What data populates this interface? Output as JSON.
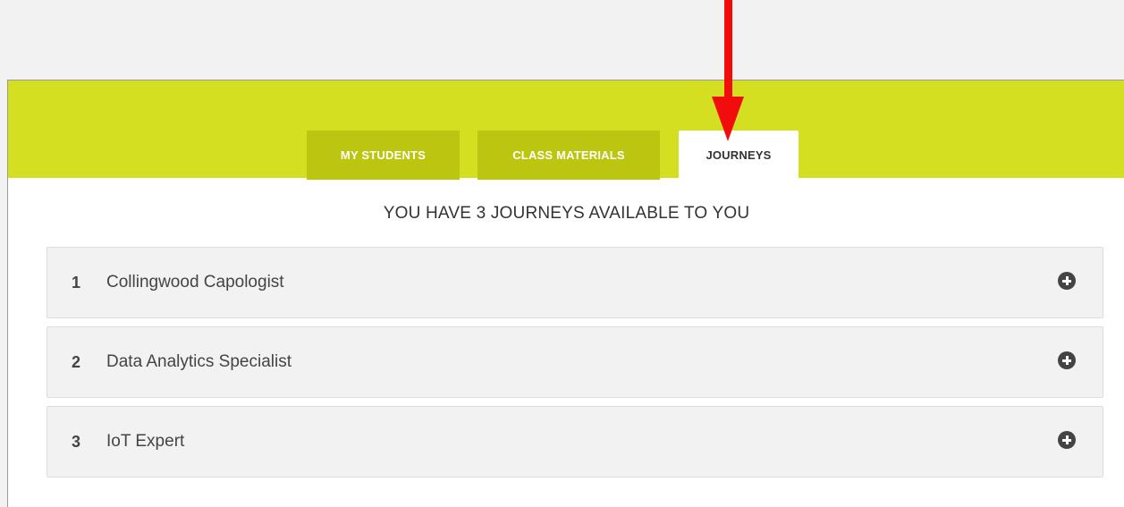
{
  "tabs": [
    {
      "label": "MY STUDENTS",
      "active": false
    },
    {
      "label": "CLASS MATERIALS",
      "active": false
    },
    {
      "label": "JOURNEYS",
      "active": true
    }
  ],
  "headline": "YOU HAVE 3 JOURNEYS AVAILABLE TO YOU",
  "journeys": [
    {
      "number": "1",
      "name": "Collingwood Capologist",
      "icon": "plus-circle-icon"
    },
    {
      "number": "2",
      "name": "Data Analytics Specialist",
      "icon": "plus-circle-icon"
    },
    {
      "number": "3",
      "name": "IoT Expert",
      "icon": "plus-circle-icon"
    }
  ],
  "annotation": {
    "icon": "down-arrow-icon",
    "color": "#f20d0d"
  },
  "colors": {
    "header_band": "#d4df22",
    "inactive_tab": "#bcc50f",
    "active_tab": "#ffffff",
    "row_background": "#f2f2f2"
  }
}
